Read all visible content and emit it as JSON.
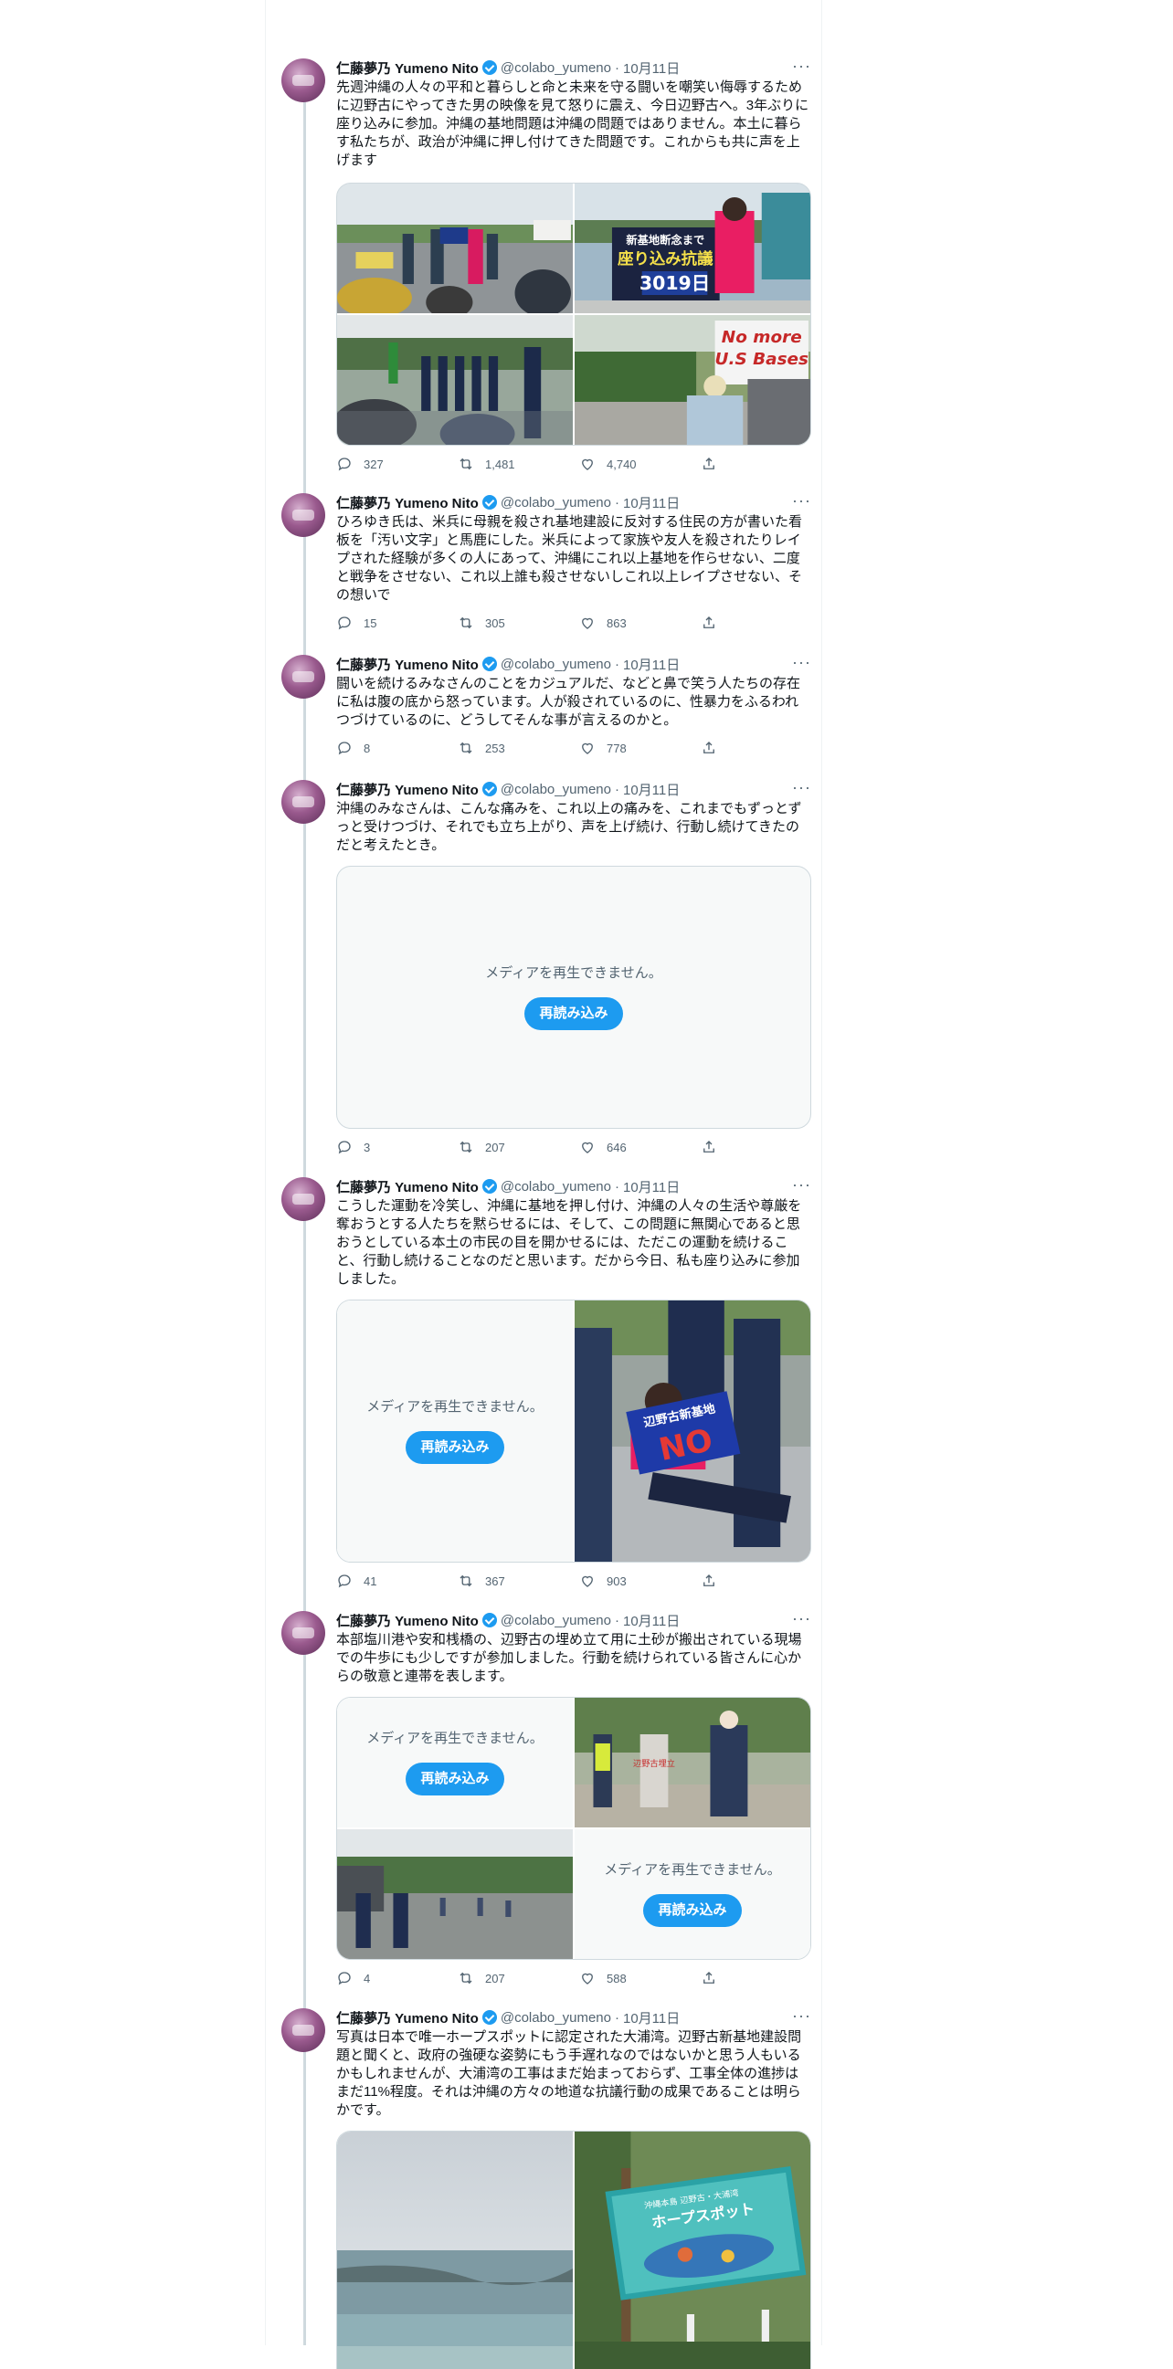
{
  "author": {
    "name": "仁藤夢乃 Yumeno Nito",
    "handle": "@colabo_yumeno",
    "separator": "·"
  },
  "more_label": "···",
  "unplayable_text": "メディアを再生できません。",
  "reload_label": "再読み込み",
  "tweets": [
    {
      "date": "10月11日",
      "text": "先週沖縄の人々の平和と暮らしと命と未来を守る闘いを嘲笑い侮辱するために辺野古にやってきた男の映像を見て怒りに震え、今日辺野古へ。3年ぶりに座り込みに参加。沖縄の基地問題は沖縄の問題ではありません。本土に暮らす私たちが、政治が沖縄に押し付けてきた問題です。これからも共に声を上げます",
      "replies": "327",
      "retweets": "1,481",
      "likes": "4,740",
      "photo_text": {
        "sign_banner": "新基地断念まで",
        "sit_in": "座り込み抗議",
        "days": "3019日",
        "no_more": "No more",
        "us_bases": "U.S Bases"
      }
    },
    {
      "date": "10月11日",
      "text": "ひろゆき氏は、米兵に母親を殺され基地建設に反対する住民の方が書いた看板を「汚い文字」と馬鹿にした。米兵によって家族や友人を殺されたりレイプされた経験が多くの人にあって、沖縄にこれ以上基地を作らせない、二度と戦争をさせない、これ以上誰も殺させないしこれ以上レイプさせない、その想いで",
      "replies": "15",
      "retweets": "305",
      "likes": "863"
    },
    {
      "date": "10月11日",
      "text": "闘いを続けるみなさんのことをカジュアルだ、などと鼻で笑う人たちの存在に私は腹の底から怒っています。人が殺されているのに、性暴力をふるわれつづけているのに、どうしてそんな事が言えるのかと。",
      "replies": "8",
      "retweets": "253",
      "likes": "778"
    },
    {
      "date": "10月11日",
      "text": "沖縄のみなさんは、こんな痛みを、これ以上の痛みを、これまでもずっとずっと受けつづけ、それでも立ち上がり、声を上げ続け、行動し続けてきたのだと考えたとき。",
      "replies": "3",
      "retweets": "207",
      "likes": "646"
    },
    {
      "date": "10月11日",
      "text": "こうした運動を冷笑し、沖縄に基地を押し付け、沖縄の人々の生活や尊厳を奪おうとする人たちを黙らせるには、そして、この問題に無関心であると思おうとしている本土の市民の目を開かせるには、ただこの運動を続けること、行動し続けることなのだと思います。だから今日、私も座り込みに参加しました。",
      "replies": "41",
      "retweets": "367",
      "likes": "903",
      "photo_text": {
        "sign_a": "辺野古新基地",
        "sign_b": "NO"
      }
    },
    {
      "date": "10月11日",
      "text": "本部塩川港や安和桟橋の、辺野古の埋め立て用に土砂が搬出されている現場での牛歩にも少しですが参加しました。行動を続けられている皆さんに心からの敬意と連帯を表します。",
      "replies": "4",
      "retweets": "207",
      "likes": "588",
      "photo_text": {
        "sign": "辺野古埋立"
      }
    },
    {
      "date": "10月11日",
      "text": "写真は日本で唯一ホープスポットに認定された大浦湾。辺野古新基地建設問題と聞くと、政府の強硬な姿勢にもう手遅れなのではないかと思う人もいるかもしれませんが、大浦湾の工事はまだ始まっておらず、工事全体の進捗はまだ11%程度。それは沖縄の方々の地道な抗議行動の成果であることは明らかです。",
      "photo_text": {
        "sign_small": "沖縄本島 辺野古・大浦湾",
        "sign_title": "ホープスポット"
      }
    }
  ],
  "colors": {
    "accent": "#1d9bf0",
    "text": "#0f1419",
    "muted": "#536471",
    "border": "#cfd9de",
    "verified": "#1d9bf0"
  },
  "icons": [
    "verified-badge-icon",
    "reply-icon",
    "retweet-icon",
    "like-icon",
    "share-icon",
    "more-icon"
  ]
}
